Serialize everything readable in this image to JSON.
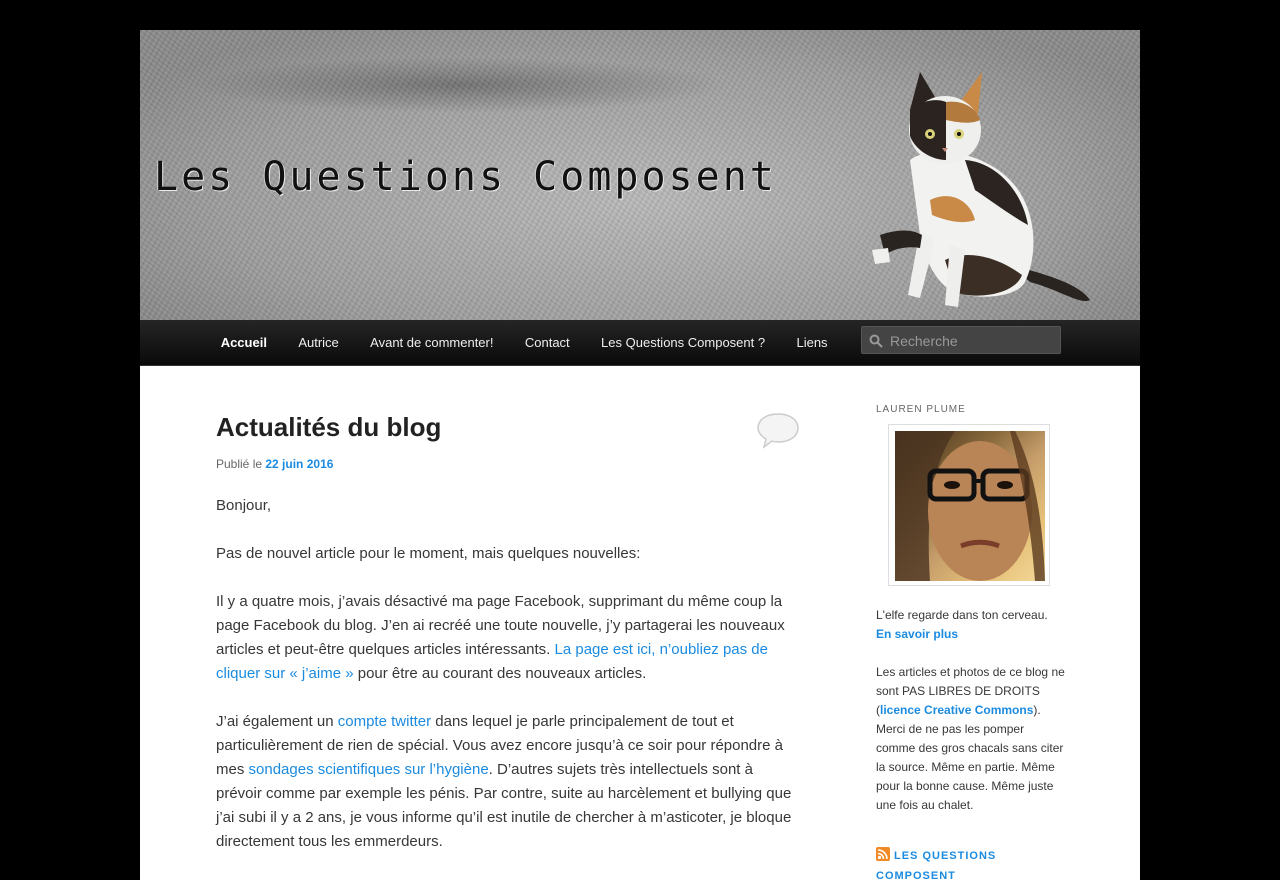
{
  "header": {
    "site_title": "Les Questions Composent"
  },
  "nav": {
    "items": [
      {
        "label": "Accueil",
        "active": true
      },
      {
        "label": "Autrice",
        "active": false
      },
      {
        "label": "Avant de commenter!",
        "active": false
      },
      {
        "label": "Contact",
        "active": false
      },
      {
        "label": "Les Questions Composent ?",
        "active": false
      },
      {
        "label": "Liens",
        "active": false
      }
    ],
    "search_placeholder": "Recherche",
    "search_value": ""
  },
  "post": {
    "title": "Actualités du blog",
    "meta_prefix": "Publié le ",
    "date": "22 juin 2016",
    "p1": "Bonjour,",
    "p2": "Pas de nouvel article pour le moment, mais quelques nouvelles:",
    "p3_text": "Il y a quatre mois, j’avais désactivé ma page Facebook, supprimant du même coup la page Facebook du blog. J’en ai recréé une toute nouvelle, j’y partagerai les nouveaux articles et peut-être quelques articles intéressants. ",
    "p3_link": "La page est ici, n’oubliez pas de cliquer sur « j’aime »",
    "p3_end": " pour être au courant des nouveaux articles.",
    "p4_a": "J’ai également un ",
    "p4_link1": "compte twitter",
    "p4_b": " dans lequel je parle principalement de tout et particulièrement de rien de spécial. Vous avez encore jusqu’à ce soir pour répondre à mes ",
    "p4_link2": "sondages scientifiques sur l’hygiène",
    "p4_c": ". D’autres sujets très intellectuels sont à prévoir comme par exemple les pénis. Par contre, suite au harcèlement et bullying que j’ai subi il y a 2 ans, je vous informe qu’il est inutile de chercher à m’asticoter, je bloque directement tous les emmerdeurs."
  },
  "sidebar": {
    "widget_title": "LAUREN PLUME",
    "bio_text": "L'elfe regarde dans ton cerveau.",
    "bio_link": "En savoir plus",
    "rights_a": "Les articles et photos de ce blog ne sont PAS LIBRES DE DROITS (",
    "rights_link": "licence Creative Commons",
    "rights_b": "). Merci de ne pas les pomper comme des gros chacals sans citer la source. Même en partie. Même pour la bonne cause. Même juste une fois au chalet.",
    "rss_label": "Les Questions Composent"
  },
  "colors": {
    "link": "#1b8be0",
    "nav_bg": "#1a1a1a",
    "page_bg": "#000000"
  },
  "icons": [
    "search-icon",
    "comment-bubble-icon",
    "rss-icon"
  ]
}
